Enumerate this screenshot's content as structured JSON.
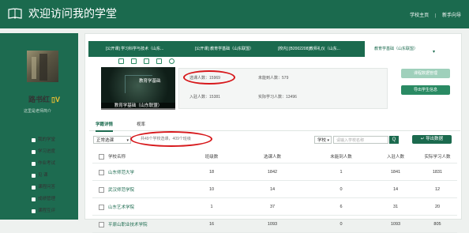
{
  "header": {
    "title": "欢迎访问我的学堂",
    "links": [
      "学校主页",
      "|",
      "新手向导"
    ]
  },
  "profile": {
    "name": "路书红",
    "vip": "V",
    "subtitle": "这里是老师简介"
  },
  "sidebar": {
    "items": [
      {
        "label": "我的学堂",
        "icon": "home-icon"
      },
      {
        "label": "学习进度",
        "icon": "progress-icon"
      },
      {
        "label": "作业考试",
        "icon": "exam-icon"
      },
      {
        "label": "见 课",
        "icon": "class-icon"
      },
      {
        "label": "课程问答",
        "icon": "qa-icon"
      },
      {
        "label": "成绩管理",
        "icon": "grade-icon"
      },
      {
        "label": "课程互评",
        "icon": "review-icon"
      }
    ]
  },
  "course_tabs": [
    "[公开课] 学习科学与技术（山东...",
    "[公开课] 教育学基础（山东联盟）",
    "[校内] [B2002208]教师礼仪（山东...",
    "教育学基础（山东联盟）"
  ],
  "course": {
    "thumb_title": "教育学基础",
    "caption": "教育学基础（山东联盟）",
    "stats": {
      "enrolled_label": "选课人数：",
      "enrolled": "15969",
      "not_visited_label": "未能到人数：",
      "not_visited": "579",
      "visited_label": "入驻人数：",
      "visited": "15381",
      "learning_label": "实际学习人数：",
      "learning": "13496"
    },
    "buttons": {
      "manage": "课程数据管理",
      "export_students": "导出学生信息"
    }
  },
  "subtabs": [
    "学籍详情",
    "视率"
  ],
  "filter": {
    "status_select": "正常选课",
    "summary": "共49个学校选课，409个班级",
    "scope_select": "学校",
    "search_placeholder": "请输入学校名称",
    "search_button": "Q",
    "export_button": "导出数据"
  },
  "table": {
    "headers": [
      "学校名称",
      "班级数",
      "选课人数",
      "未能到人数",
      "入驻人数",
      "实际学习人数"
    ],
    "rows": [
      [
        "山东师范大学",
        "18",
        "1842",
        "1",
        "1841",
        "1831"
      ],
      [
        "武汉师范学院",
        "10",
        "14",
        "0",
        "14",
        "12"
      ],
      [
        "山东艺术学院",
        "1",
        "37",
        "6",
        "31",
        "20"
      ],
      [
        "平原山职业技术学院",
        "16",
        "1093",
        "0",
        "1093",
        "805"
      ]
    ]
  },
  "colors": {
    "brand": "#1b6a4e",
    "accent": "#2a8a63",
    "highlight": "#d7191c"
  }
}
